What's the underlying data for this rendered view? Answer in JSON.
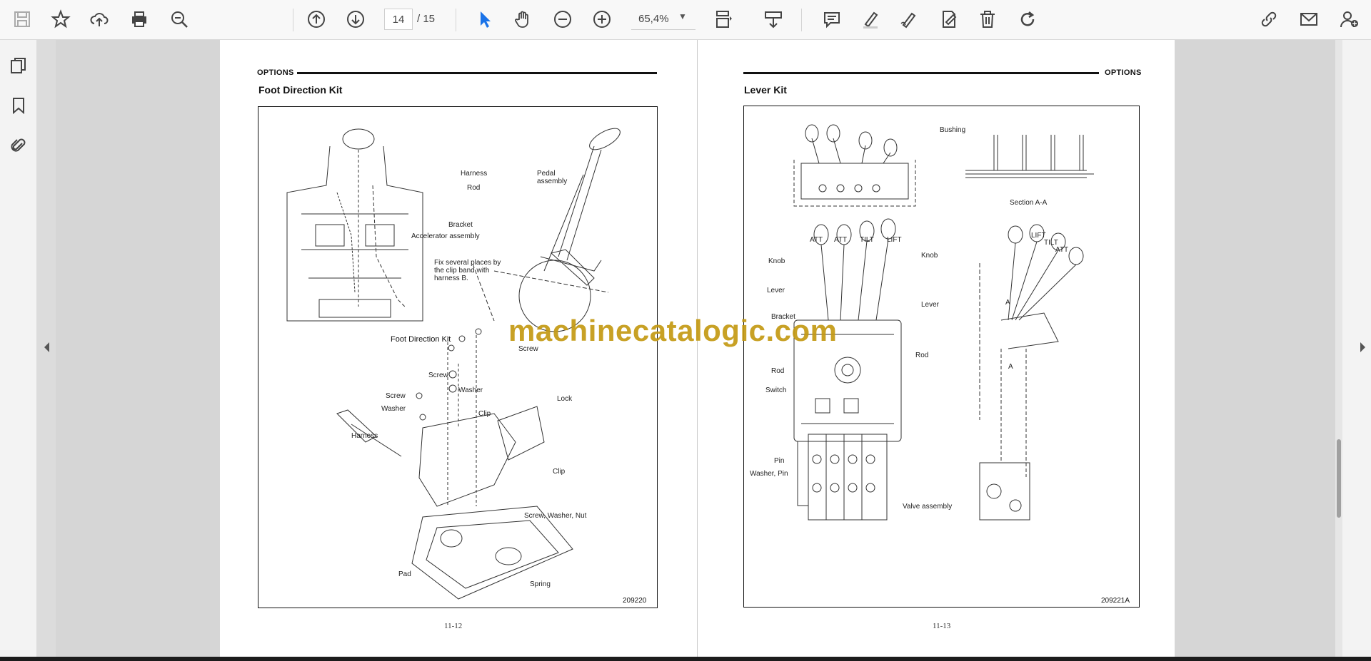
{
  "toolbar": {
    "page_current": "14",
    "page_total": "/ 15",
    "zoom": "65,4%"
  },
  "colors": {
    "accent": "#1a73e8",
    "toolbar_bg": "#f8f8f8",
    "watermark": "#c49a13"
  },
  "icons": [
    "save-icon",
    "star-icon",
    "cloud-upload-icon",
    "print-icon",
    "zoom-search-icon",
    "prev-page-icon",
    "next-page-icon",
    "select-cursor-icon",
    "hand-icon",
    "zoom-out-icon",
    "zoom-in-icon",
    "page-fit-icon",
    "scroll-mode-icon",
    "comment-icon",
    "highlight-icon",
    "draw-icon",
    "fill-sign-icon",
    "delete-icon",
    "rotate-icon",
    "share-link-icon",
    "email-icon",
    "account-icon",
    "pages-thumbnail-icon",
    "bookmark-icon",
    "attachment-icon"
  ],
  "left_page": {
    "header": "OPTIONS",
    "title": "Foot Direction Kit",
    "caption": "Foot Direction Kit",
    "figure_id": "209220",
    "page_number": "11-12",
    "labels": {
      "harness_top": "Harness",
      "rod": "Rod",
      "pedal_assembly": "Pedal\nassembly",
      "bracket": "Bracket",
      "accelerator": "Accelerator assembly",
      "fix_note": "Fix several places by\nthe clip band with\nharness B.",
      "screw_1": "Screw",
      "screw_2": "Screw",
      "screw_3": "Screw",
      "washer_1": "Washer",
      "washer_2": "Washer",
      "lock": "Lock",
      "clip_1": "Clip",
      "clip_2": "Clip",
      "harness": "Harness",
      "screw_washer_nut": "Screw, Washer, Nut",
      "pad": "Pad",
      "spring": "Spring"
    }
  },
  "right_page": {
    "header": "OPTIONS",
    "title": "Lever Kit",
    "figure_id": "209221A",
    "page_number": "11-13",
    "labels": {
      "bushing": "Bushing",
      "section": "Section A-A",
      "att1": "ATT",
      "att2": "ATT",
      "tilt": "TILT",
      "lift": "LIFT",
      "knob_l": "Knob",
      "knob_r": "Knob",
      "lever_l": "Lever",
      "lever_r": "Lever",
      "bracket": "Bracket",
      "rod_l": "Rod",
      "rod_r": "Rod",
      "switch": "Switch",
      "pin": "Pin",
      "washer_pin": "Washer, Pin",
      "valve": "Valve assembly",
      "lift2": "LIFT",
      "tilt2": "TILT",
      "att3": "ATT",
      "a_top": "A",
      "a_bot": "A"
    }
  },
  "watermark": "machinecatalogic.com"
}
